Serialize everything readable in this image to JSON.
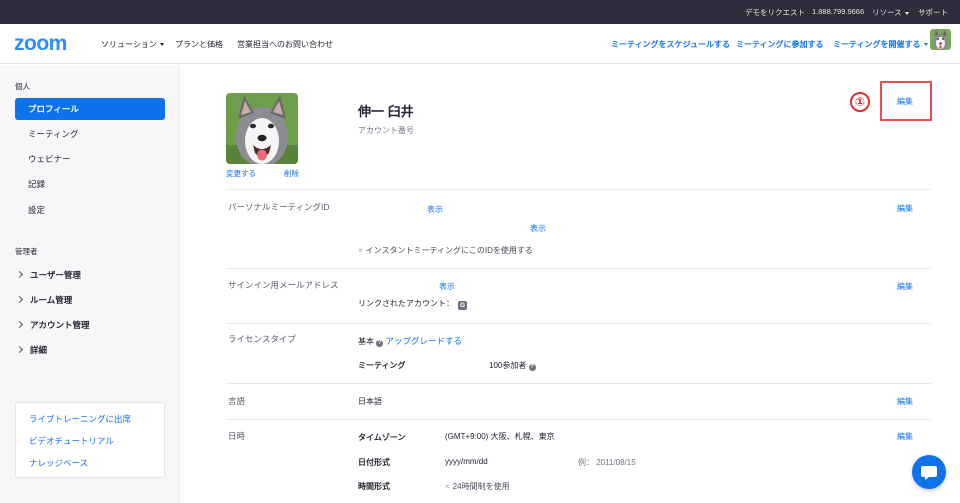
{
  "topbar": {
    "demo": "デモをリクエスト",
    "phone": "1.888.799.9666",
    "resources": "リソース",
    "support": "サポート"
  },
  "nav": {
    "logo": "zoom",
    "solutions": "ソリューション",
    "plans": "プランと価格",
    "contact_sales": "営業担当へのお問い合わせ",
    "schedule": "ミーティングをスケジュールする",
    "join": "ミーティングに参加する",
    "host": "ミーティングを開催する"
  },
  "sidebar": {
    "personal_heading": "個人",
    "items": [
      "プロフィール",
      "ミーティング",
      "ウェビナー",
      "記録",
      "設定"
    ],
    "admin_heading": "管理者",
    "admin_items": [
      "ユーザー管理",
      "ルーム管理",
      "アカウント管理",
      "詳細"
    ],
    "links": [
      "ライブトレーニングに出席",
      "ビデオチュートリアル",
      "ナレッジベース"
    ]
  },
  "profile": {
    "change": "変更する",
    "delete": "削除",
    "name": "伸一 臼井",
    "account_number": "アカウント番号",
    "annotation": "①",
    "edit": "編集"
  },
  "rows": {
    "pmi": {
      "label": "パーソナルミーティングID",
      "show1": "表示",
      "show2": "表示",
      "instant": "インスタントミーティングにこのIDを使用する",
      "edit": "編集"
    },
    "email": {
      "label": "サインイン用メールアドレス",
      "show": "表示",
      "linked": "リンクされたアカウント：",
      "linked_icon": "G",
      "edit": "編集"
    },
    "license": {
      "label": "ライセンスタイプ",
      "basic": "基本",
      "upgrade": "アップグレードする",
      "meeting": "ミーティング",
      "participants": "100参加者"
    },
    "language": {
      "label": "言語",
      "value": "日本語",
      "edit": "編集"
    },
    "datetime": {
      "label": "日時",
      "timezone_label": "タイムゾーン",
      "timezone_value": "(GMT+9:00) 大阪、札幌、東京",
      "date_label": "日付形式",
      "date_value": "yyyy/mm/dd",
      "example": "例：  2011/08/15",
      "time_label": "時間形式",
      "time_value": "24時間制を使用",
      "edit": "編集"
    }
  },
  "colors": {
    "brand": "#0e72ed",
    "topbar": "#2d2d3b",
    "annotation": "#e02f2f"
  }
}
